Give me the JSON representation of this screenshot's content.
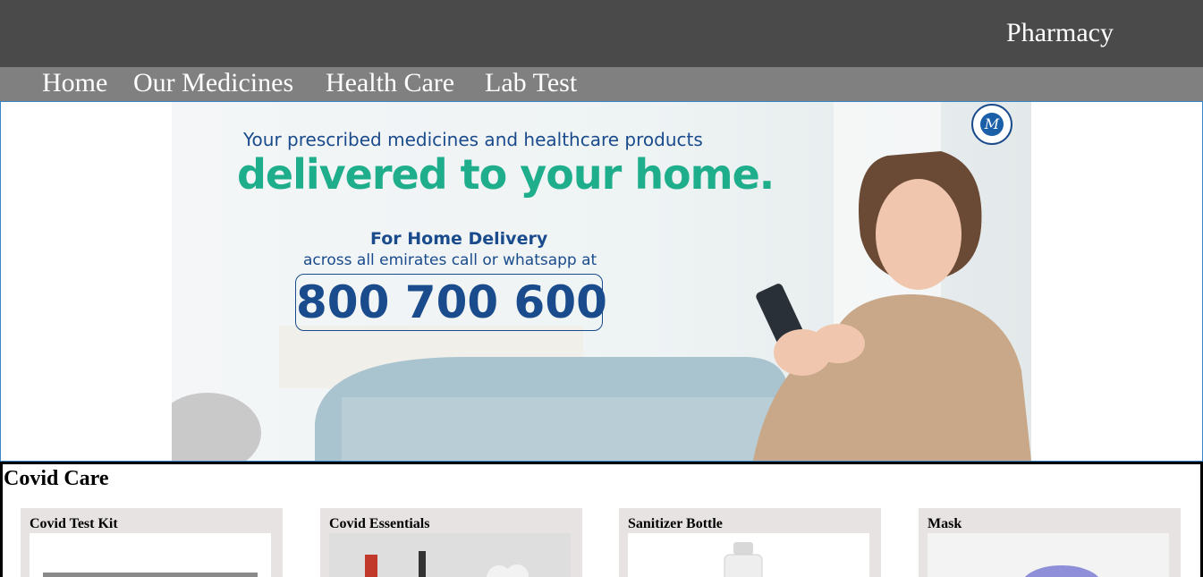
{
  "header": {
    "brand": "Pharmacy"
  },
  "nav": {
    "items": [
      "Home",
      "Our Medicines",
      "Health Care",
      "Lab Test"
    ]
  },
  "banner": {
    "line1": "Your prescribed medicines and healthcare products",
    "line2": "delivered to your home.",
    "line3": "For Home Delivery",
    "line4": "across all emirates call or whatsapp at",
    "phone": "800 700 600",
    "colors": {
      "navy": "#1a4b8c",
      "teal": "#1fae8c"
    }
  },
  "covid": {
    "title": "Covid Care",
    "cards": [
      {
        "title": "Covid Test Kit"
      },
      {
        "title": "Covid Essentials"
      },
      {
        "title": "Sanitizer Bottle"
      },
      {
        "title": "Mask"
      }
    ]
  },
  "colors": {
    "topbar": "#4a4a4a",
    "navbar": "#808080",
    "card": "#e7e3e3"
  }
}
